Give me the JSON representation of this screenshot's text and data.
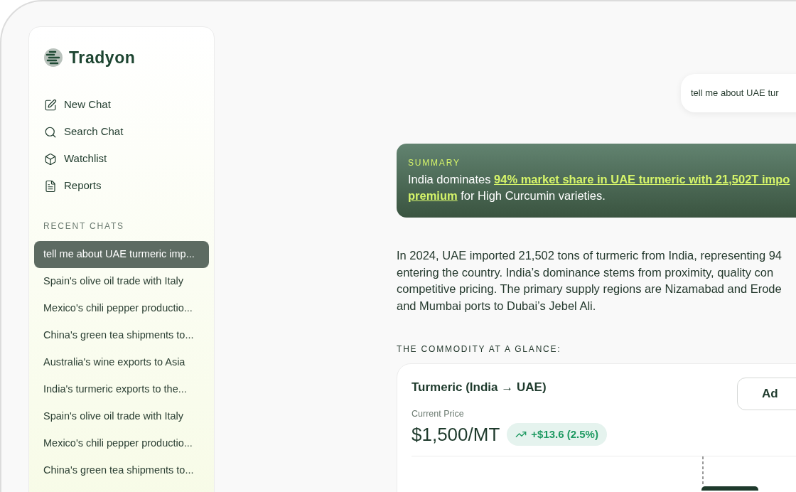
{
  "sidebar": {
    "brand": "Tradyon",
    "nav": [
      {
        "label": "New Chat"
      },
      {
        "label": "Search Chat"
      },
      {
        "label": "Watchlist"
      },
      {
        "label": "Reports"
      }
    ],
    "recent_title": "RECENT CHATS",
    "recent": [
      {
        "label": "tell me about UAE turmeric imp...",
        "selected": true
      },
      {
        "label": "Spain's olive oil trade with Italy",
        "selected": false
      },
      {
        "label": "Mexico's chili pepper productio...",
        "selected": false
      },
      {
        "label": "China's green tea shipments to...",
        "selected": false
      },
      {
        "label": "Australia's wine exports to Asia",
        "selected": false
      },
      {
        "label": "India's turmeric exports to the...",
        "selected": false
      },
      {
        "label": "Spain's olive oil trade with Italy",
        "selected": false
      },
      {
        "label": "Mexico's chili pepper productio...",
        "selected": false
      },
      {
        "label": "China's green tea shipments to...",
        "selected": false
      }
    ]
  },
  "user_message": "tell me about UAE tur",
  "summary": {
    "title": "SUMMARY",
    "lines": [
      [
        {
          "text": "India dominates ",
          "highlight": false
        },
        {
          "text": "94% market share in UAE turmeric with 21,502T impo",
          "highlight": true
        }
      ],
      [
        {
          "text": "premium",
          "highlight": true
        },
        {
          "text": " for High Curcumin varieties.",
          "highlight": false
        }
      ]
    ]
  },
  "body_lines": [
    "In 2024, UAE imported 21,502 tons of turmeric from India, representing 94",
    "entering the country. India’s dominance stems from proximity, quality con",
    "competitive pricing. The primary supply regions are Nizamabad and Erode",
    "and Mumbai ports to Dubai’s Jebel Ali."
  ],
  "glance_title": "THE COMMODITY AT A GLANCE:",
  "card": {
    "title": "Turmeric (India → UAE)",
    "button": "Ad",
    "price_label": "Current Price",
    "price": "$1,500/MT",
    "change": "+$13.6 (2.5%)"
  }
}
